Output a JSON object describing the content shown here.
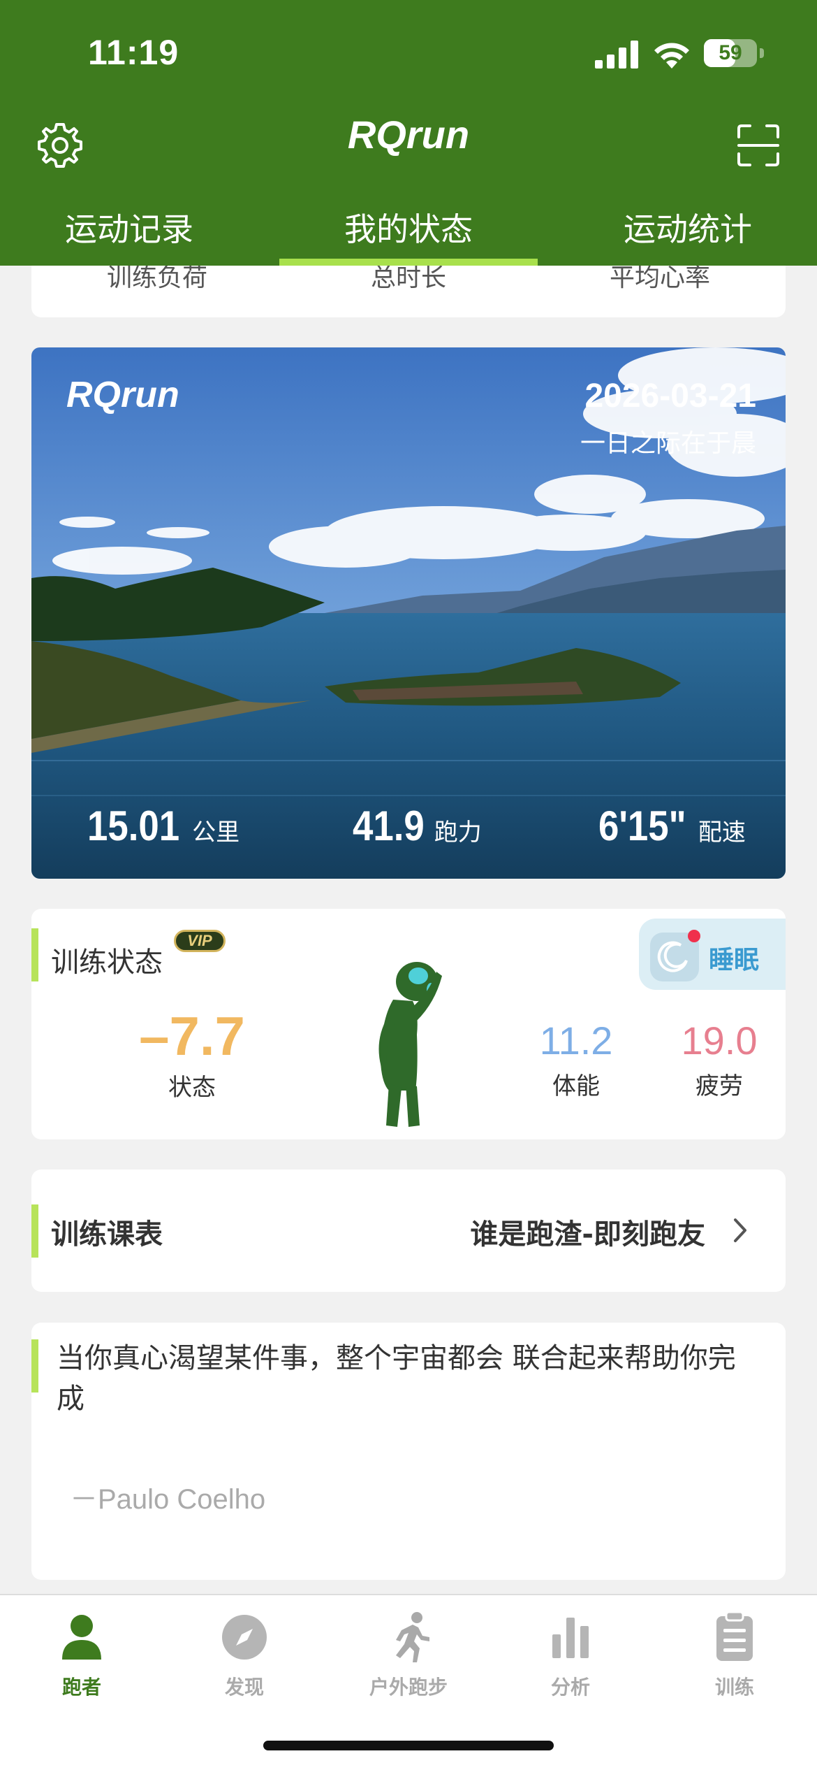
{
  "status_bar": {
    "time": "11:19",
    "battery": "59",
    "battery_level": 0.59
  },
  "header": {
    "title": "RQrun",
    "settings_icon": "gear-icon",
    "scan_icon": "scan-icon",
    "tabs": [
      {
        "label": "运动记录"
      },
      {
        "label": "我的状态",
        "active": true
      },
      {
        "label": "运动统计"
      }
    ]
  },
  "summary": {
    "labels": [
      "训练负荷",
      "总时长",
      "平均心率"
    ]
  },
  "photo_card": {
    "brand": "RQrun",
    "date": "2026-03-21",
    "quote": "一日之际在于晨",
    "stats": [
      {
        "value": "15.01",
        "unit": "公里"
      },
      {
        "value": "41.9",
        "unit": "跑力"
      },
      {
        "value": "6'15\"",
        "unit": "配速"
      }
    ]
  },
  "training_state": {
    "title": "训练状态",
    "vip": "VIP",
    "sleep_label": "睡眠",
    "state_value": "–7.7",
    "state_label": "状态",
    "fitness_value": "11.2",
    "fitness_label": "体能",
    "fatigue_value": "19.0",
    "fatigue_label": "疲劳",
    "colors": {
      "state": "#f1b860",
      "fitness": "#7eaee6",
      "fatigue": "#e77f8f"
    }
  },
  "plan": {
    "title": "训练课表",
    "value": "谁是跑渣-即刻跑友"
  },
  "quote": {
    "text": "当你真心渴望某件事，整个宇宙都会 联合起来帮助你完成",
    "author": "－Paulo Coelho"
  },
  "bottom_nav": [
    {
      "label": "跑者",
      "icon": "person-icon",
      "active": true
    },
    {
      "label": "发现",
      "icon": "compass-icon"
    },
    {
      "label": "户外跑步",
      "icon": "runner-icon"
    },
    {
      "label": "分析",
      "icon": "bar-chart-icon"
    },
    {
      "label": "训练",
      "icon": "clipboard-icon"
    }
  ],
  "colors": {
    "brand_green": "#3e7b1e",
    "accent_lime": "#a8e04c"
  }
}
